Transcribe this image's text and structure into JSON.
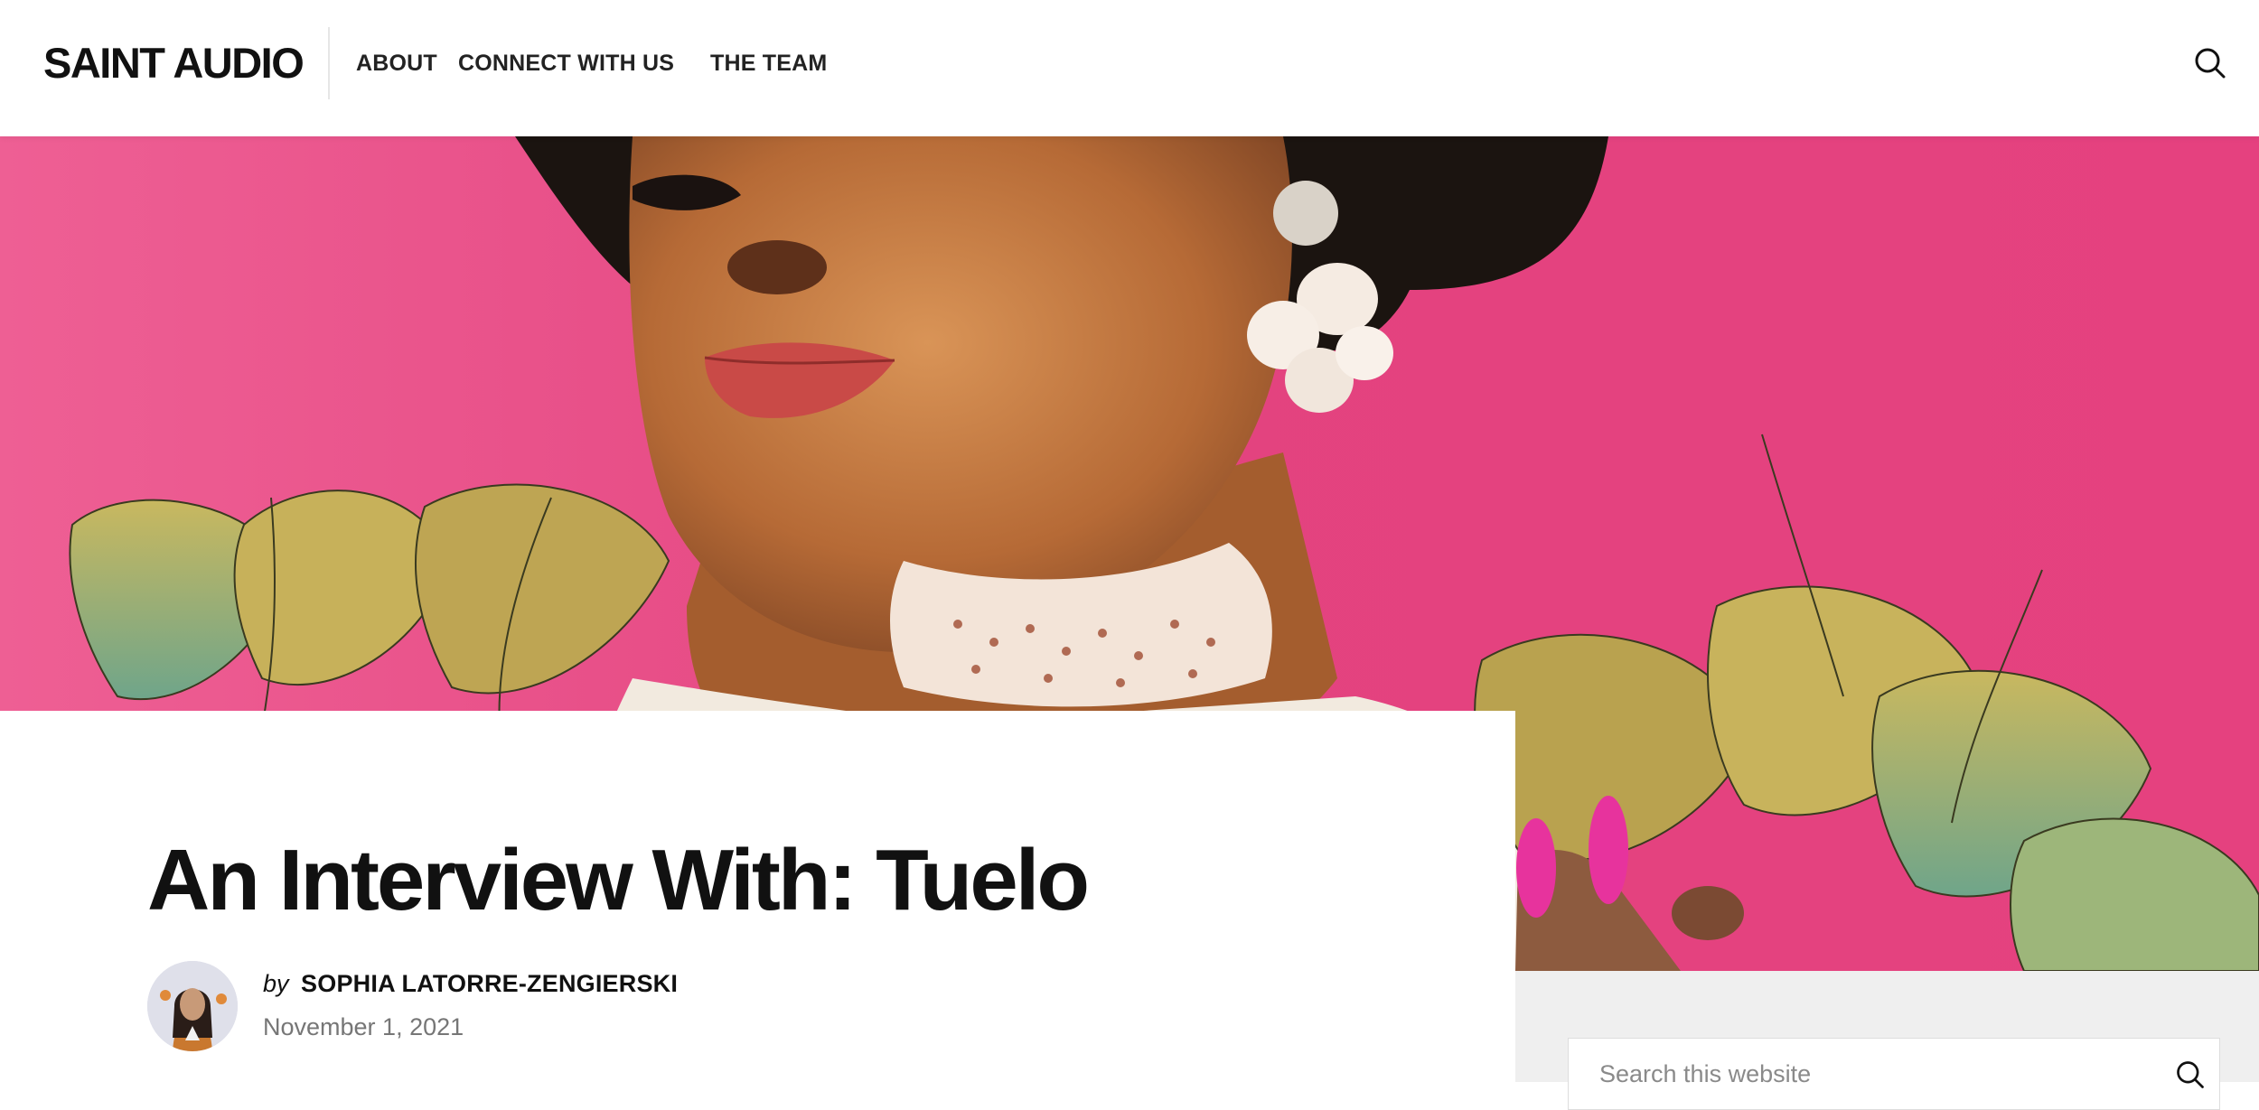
{
  "site": {
    "logo": "SAINT AUDIO"
  },
  "nav": {
    "items": [
      {
        "label": "ABOUT"
      },
      {
        "label": "CONNECT WITH US"
      },
      {
        "label": "THE TEAM"
      }
    ],
    "search_icon": "search-icon"
  },
  "hero": {
    "image": "illustrated-portrait-hero"
  },
  "article": {
    "title": "An Interview With: Tuelo",
    "by_prefix": "by",
    "author": "SOPHIA LATORRE-ZENGIERSKI",
    "date": "November 1, 2021",
    "avatar": "author-avatar"
  },
  "sidebar": {
    "search": {
      "placeholder": "Search this website",
      "icon": "search-icon"
    }
  },
  "colors": {
    "hero_pink": "#e5417f",
    "sidebar_gray": "#efefef",
    "text": "#111111",
    "date_gray": "#767676"
  }
}
